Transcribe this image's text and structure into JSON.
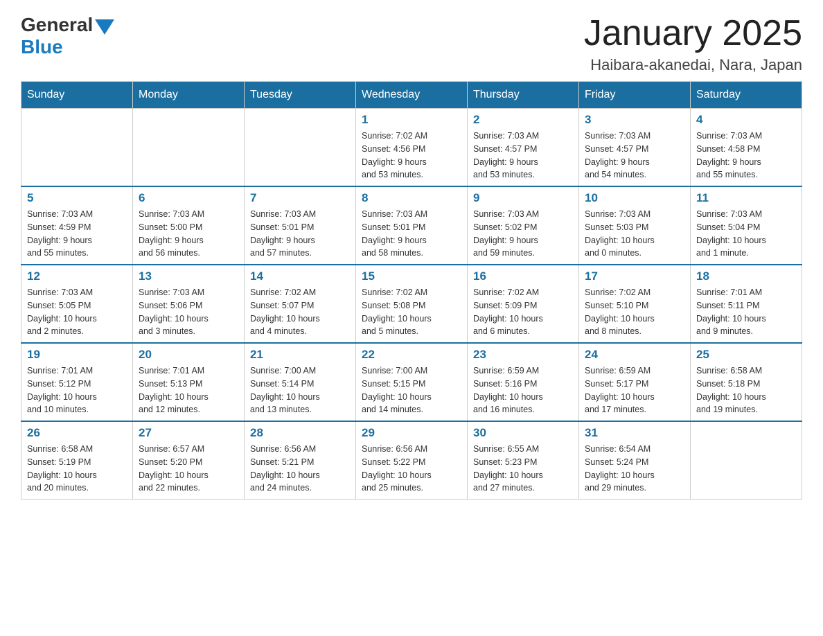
{
  "logo": {
    "general": "General",
    "blue": "Blue"
  },
  "title": "January 2025",
  "subtitle": "Haibara-akanedai, Nara, Japan",
  "days_of_week": [
    "Sunday",
    "Monday",
    "Tuesday",
    "Wednesday",
    "Thursday",
    "Friday",
    "Saturday"
  ],
  "weeks": [
    [
      {
        "day": "",
        "info": ""
      },
      {
        "day": "",
        "info": ""
      },
      {
        "day": "",
        "info": ""
      },
      {
        "day": "1",
        "info": "Sunrise: 7:02 AM\nSunset: 4:56 PM\nDaylight: 9 hours\nand 53 minutes."
      },
      {
        "day": "2",
        "info": "Sunrise: 7:03 AM\nSunset: 4:57 PM\nDaylight: 9 hours\nand 53 minutes."
      },
      {
        "day": "3",
        "info": "Sunrise: 7:03 AM\nSunset: 4:57 PM\nDaylight: 9 hours\nand 54 minutes."
      },
      {
        "day": "4",
        "info": "Sunrise: 7:03 AM\nSunset: 4:58 PM\nDaylight: 9 hours\nand 55 minutes."
      }
    ],
    [
      {
        "day": "5",
        "info": "Sunrise: 7:03 AM\nSunset: 4:59 PM\nDaylight: 9 hours\nand 55 minutes."
      },
      {
        "day": "6",
        "info": "Sunrise: 7:03 AM\nSunset: 5:00 PM\nDaylight: 9 hours\nand 56 minutes."
      },
      {
        "day": "7",
        "info": "Sunrise: 7:03 AM\nSunset: 5:01 PM\nDaylight: 9 hours\nand 57 minutes."
      },
      {
        "day": "8",
        "info": "Sunrise: 7:03 AM\nSunset: 5:01 PM\nDaylight: 9 hours\nand 58 minutes."
      },
      {
        "day": "9",
        "info": "Sunrise: 7:03 AM\nSunset: 5:02 PM\nDaylight: 9 hours\nand 59 minutes."
      },
      {
        "day": "10",
        "info": "Sunrise: 7:03 AM\nSunset: 5:03 PM\nDaylight: 10 hours\nand 0 minutes."
      },
      {
        "day": "11",
        "info": "Sunrise: 7:03 AM\nSunset: 5:04 PM\nDaylight: 10 hours\nand 1 minute."
      }
    ],
    [
      {
        "day": "12",
        "info": "Sunrise: 7:03 AM\nSunset: 5:05 PM\nDaylight: 10 hours\nand 2 minutes."
      },
      {
        "day": "13",
        "info": "Sunrise: 7:03 AM\nSunset: 5:06 PM\nDaylight: 10 hours\nand 3 minutes."
      },
      {
        "day": "14",
        "info": "Sunrise: 7:02 AM\nSunset: 5:07 PM\nDaylight: 10 hours\nand 4 minutes."
      },
      {
        "day": "15",
        "info": "Sunrise: 7:02 AM\nSunset: 5:08 PM\nDaylight: 10 hours\nand 5 minutes."
      },
      {
        "day": "16",
        "info": "Sunrise: 7:02 AM\nSunset: 5:09 PM\nDaylight: 10 hours\nand 6 minutes."
      },
      {
        "day": "17",
        "info": "Sunrise: 7:02 AM\nSunset: 5:10 PM\nDaylight: 10 hours\nand 8 minutes."
      },
      {
        "day": "18",
        "info": "Sunrise: 7:01 AM\nSunset: 5:11 PM\nDaylight: 10 hours\nand 9 minutes."
      }
    ],
    [
      {
        "day": "19",
        "info": "Sunrise: 7:01 AM\nSunset: 5:12 PM\nDaylight: 10 hours\nand 10 minutes."
      },
      {
        "day": "20",
        "info": "Sunrise: 7:01 AM\nSunset: 5:13 PM\nDaylight: 10 hours\nand 12 minutes."
      },
      {
        "day": "21",
        "info": "Sunrise: 7:00 AM\nSunset: 5:14 PM\nDaylight: 10 hours\nand 13 minutes."
      },
      {
        "day": "22",
        "info": "Sunrise: 7:00 AM\nSunset: 5:15 PM\nDaylight: 10 hours\nand 14 minutes."
      },
      {
        "day": "23",
        "info": "Sunrise: 6:59 AM\nSunset: 5:16 PM\nDaylight: 10 hours\nand 16 minutes."
      },
      {
        "day": "24",
        "info": "Sunrise: 6:59 AM\nSunset: 5:17 PM\nDaylight: 10 hours\nand 17 minutes."
      },
      {
        "day": "25",
        "info": "Sunrise: 6:58 AM\nSunset: 5:18 PM\nDaylight: 10 hours\nand 19 minutes."
      }
    ],
    [
      {
        "day": "26",
        "info": "Sunrise: 6:58 AM\nSunset: 5:19 PM\nDaylight: 10 hours\nand 20 minutes."
      },
      {
        "day": "27",
        "info": "Sunrise: 6:57 AM\nSunset: 5:20 PM\nDaylight: 10 hours\nand 22 minutes."
      },
      {
        "day": "28",
        "info": "Sunrise: 6:56 AM\nSunset: 5:21 PM\nDaylight: 10 hours\nand 24 minutes."
      },
      {
        "day": "29",
        "info": "Sunrise: 6:56 AM\nSunset: 5:22 PM\nDaylight: 10 hours\nand 25 minutes."
      },
      {
        "day": "30",
        "info": "Sunrise: 6:55 AM\nSunset: 5:23 PM\nDaylight: 10 hours\nand 27 minutes."
      },
      {
        "day": "31",
        "info": "Sunrise: 6:54 AM\nSunset: 5:24 PM\nDaylight: 10 hours\nand 29 minutes."
      },
      {
        "day": "",
        "info": ""
      }
    ]
  ]
}
